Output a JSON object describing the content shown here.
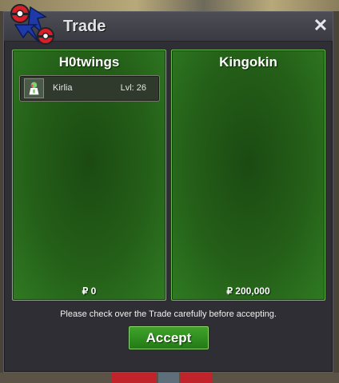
{
  "window": {
    "title": "Trade",
    "close_glyph": "✕"
  },
  "left_panel": {
    "trainer_name": "H0twings",
    "money": "₽ 0",
    "pokemon": [
      {
        "name": "Kirlia",
        "level": "Lvl: 26",
        "icon": "kirlia-sprite-icon"
      }
    ]
  },
  "right_panel": {
    "trainer_name": "Kingokin",
    "money": "₽ 200,000"
  },
  "footer": {
    "notice": "Please check over the Trade carefully before accepting.",
    "accept_label": "Accept"
  },
  "colors": {
    "panel_green": "#245f18",
    "accept_green": "#2f8f20",
    "window_bg": "#2e2e34"
  }
}
